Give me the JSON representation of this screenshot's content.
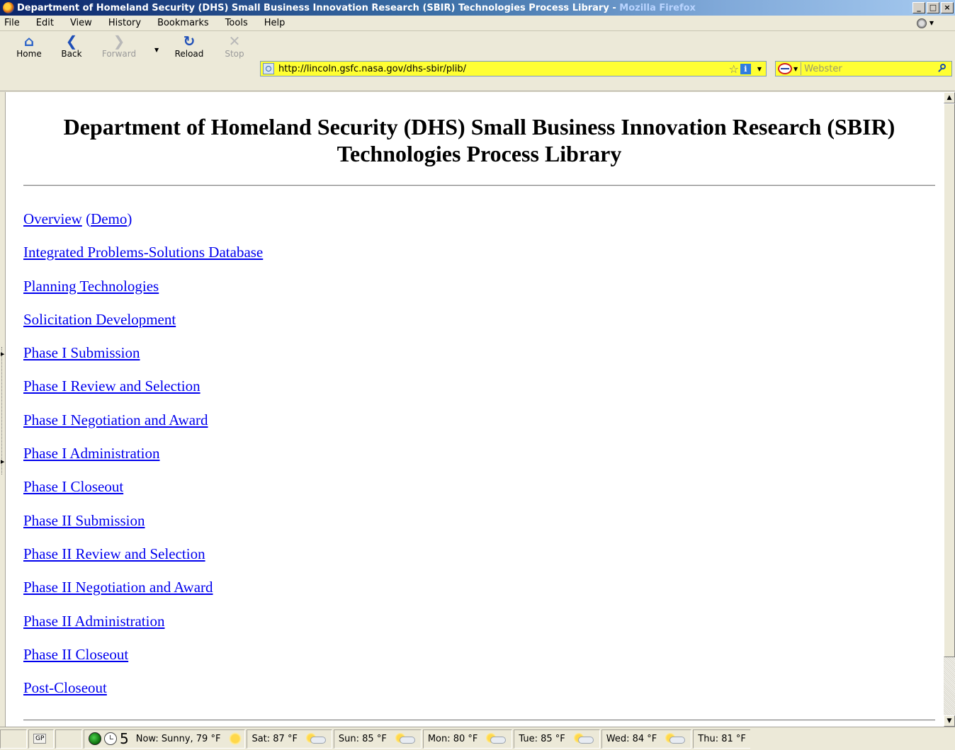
{
  "window": {
    "title": "Department of Homeland Security (DHS) Small Business Innovation Research (SBIR) Technologies Process Library",
    "title_separator": " - ",
    "app_name": "Mozilla Firefox",
    "minimize": "_",
    "maximize": "□",
    "close": "×"
  },
  "menu": {
    "file": "File",
    "edit": "Edit",
    "view": "View",
    "history": "History",
    "bookmarks": "Bookmarks",
    "tools": "Tools",
    "help": "Help"
  },
  "toolbar": {
    "home": "Home",
    "back": "Back",
    "forward": "Forward",
    "reload": "Reload",
    "stop": "Stop"
  },
  "address_bar": {
    "url": "http://lincoln.gsfc.nasa.gov/dhs-sbir/plib/",
    "background": "#ffff33"
  },
  "search_bar": {
    "placeholder": "Webster",
    "value": ""
  },
  "page": {
    "title_line1": "Department of Homeland Security (DHS) Small Business Innovation Research (SBIR)",
    "title_line2": "Technologies Process Library",
    "overview": {
      "label": "Overview",
      "demo_label": "Demo",
      "open_paren": "(",
      "close_paren": ")"
    },
    "links": [
      "Integrated Problems-Solutions Database",
      "Planning Technologies",
      "Solicitation Development",
      "Phase I Submission",
      "Phase I Review and Selection",
      "Phase I Negotiation and Award",
      "Phase I Administration",
      "Phase I Closeout",
      "Phase II Submission",
      "Phase II Review and Selection",
      "Phase II Negotiation and Award",
      "Phase II Administration",
      "Phase II Closeout",
      "Post-Closeout"
    ],
    "link_color": "#0000ee"
  },
  "status_bar": {
    "gp_badge": "GP",
    "count": "5",
    "weather": {
      "now": "Now: Sunny, 79 °F",
      "sat": "Sat: 87 °F",
      "sun": "Sun: 85 °F",
      "mon": "Mon: 80 °F",
      "tue": "Tue: 85 °F",
      "wed": "Wed: 84 °F",
      "thu": "Thu: 81 °F"
    }
  }
}
